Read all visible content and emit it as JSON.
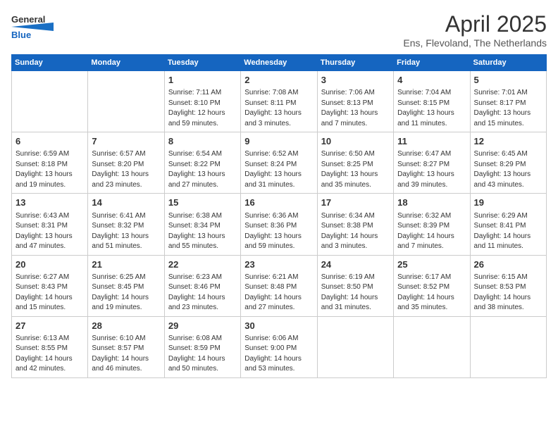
{
  "header": {
    "logo_general": "General",
    "logo_blue": "Blue",
    "month": "April 2025",
    "location": "Ens, Flevoland, The Netherlands"
  },
  "weekdays": [
    "Sunday",
    "Monday",
    "Tuesday",
    "Wednesday",
    "Thursday",
    "Friday",
    "Saturday"
  ],
  "weeks": [
    [
      {
        "day": "",
        "info": ""
      },
      {
        "day": "",
        "info": ""
      },
      {
        "day": "1",
        "info": "Sunrise: 7:11 AM\nSunset: 8:10 PM\nDaylight: 12 hours and 59 minutes."
      },
      {
        "day": "2",
        "info": "Sunrise: 7:08 AM\nSunset: 8:11 PM\nDaylight: 13 hours and 3 minutes."
      },
      {
        "day": "3",
        "info": "Sunrise: 7:06 AM\nSunset: 8:13 PM\nDaylight: 13 hours and 7 minutes."
      },
      {
        "day": "4",
        "info": "Sunrise: 7:04 AM\nSunset: 8:15 PM\nDaylight: 13 hours and 11 minutes."
      },
      {
        "day": "5",
        "info": "Sunrise: 7:01 AM\nSunset: 8:17 PM\nDaylight: 13 hours and 15 minutes."
      }
    ],
    [
      {
        "day": "6",
        "info": "Sunrise: 6:59 AM\nSunset: 8:18 PM\nDaylight: 13 hours and 19 minutes."
      },
      {
        "day": "7",
        "info": "Sunrise: 6:57 AM\nSunset: 8:20 PM\nDaylight: 13 hours and 23 minutes."
      },
      {
        "day": "8",
        "info": "Sunrise: 6:54 AM\nSunset: 8:22 PM\nDaylight: 13 hours and 27 minutes."
      },
      {
        "day": "9",
        "info": "Sunrise: 6:52 AM\nSunset: 8:24 PM\nDaylight: 13 hours and 31 minutes."
      },
      {
        "day": "10",
        "info": "Sunrise: 6:50 AM\nSunset: 8:25 PM\nDaylight: 13 hours and 35 minutes."
      },
      {
        "day": "11",
        "info": "Sunrise: 6:47 AM\nSunset: 8:27 PM\nDaylight: 13 hours and 39 minutes."
      },
      {
        "day": "12",
        "info": "Sunrise: 6:45 AM\nSunset: 8:29 PM\nDaylight: 13 hours and 43 minutes."
      }
    ],
    [
      {
        "day": "13",
        "info": "Sunrise: 6:43 AM\nSunset: 8:31 PM\nDaylight: 13 hours and 47 minutes."
      },
      {
        "day": "14",
        "info": "Sunrise: 6:41 AM\nSunset: 8:32 PM\nDaylight: 13 hours and 51 minutes."
      },
      {
        "day": "15",
        "info": "Sunrise: 6:38 AM\nSunset: 8:34 PM\nDaylight: 13 hours and 55 minutes."
      },
      {
        "day": "16",
        "info": "Sunrise: 6:36 AM\nSunset: 8:36 PM\nDaylight: 13 hours and 59 minutes."
      },
      {
        "day": "17",
        "info": "Sunrise: 6:34 AM\nSunset: 8:38 PM\nDaylight: 14 hours and 3 minutes."
      },
      {
        "day": "18",
        "info": "Sunrise: 6:32 AM\nSunset: 8:39 PM\nDaylight: 14 hours and 7 minutes."
      },
      {
        "day": "19",
        "info": "Sunrise: 6:29 AM\nSunset: 8:41 PM\nDaylight: 14 hours and 11 minutes."
      }
    ],
    [
      {
        "day": "20",
        "info": "Sunrise: 6:27 AM\nSunset: 8:43 PM\nDaylight: 14 hours and 15 minutes."
      },
      {
        "day": "21",
        "info": "Sunrise: 6:25 AM\nSunset: 8:45 PM\nDaylight: 14 hours and 19 minutes."
      },
      {
        "day": "22",
        "info": "Sunrise: 6:23 AM\nSunset: 8:46 PM\nDaylight: 14 hours and 23 minutes."
      },
      {
        "day": "23",
        "info": "Sunrise: 6:21 AM\nSunset: 8:48 PM\nDaylight: 14 hours and 27 minutes."
      },
      {
        "day": "24",
        "info": "Sunrise: 6:19 AM\nSunset: 8:50 PM\nDaylight: 14 hours and 31 minutes."
      },
      {
        "day": "25",
        "info": "Sunrise: 6:17 AM\nSunset: 8:52 PM\nDaylight: 14 hours and 35 minutes."
      },
      {
        "day": "26",
        "info": "Sunrise: 6:15 AM\nSunset: 8:53 PM\nDaylight: 14 hours and 38 minutes."
      }
    ],
    [
      {
        "day": "27",
        "info": "Sunrise: 6:13 AM\nSunset: 8:55 PM\nDaylight: 14 hours and 42 minutes."
      },
      {
        "day": "28",
        "info": "Sunrise: 6:10 AM\nSunset: 8:57 PM\nDaylight: 14 hours and 46 minutes."
      },
      {
        "day": "29",
        "info": "Sunrise: 6:08 AM\nSunset: 8:59 PM\nDaylight: 14 hours and 50 minutes."
      },
      {
        "day": "30",
        "info": "Sunrise: 6:06 AM\nSunset: 9:00 PM\nDaylight: 14 hours and 53 minutes."
      },
      {
        "day": "",
        "info": ""
      },
      {
        "day": "",
        "info": ""
      },
      {
        "day": "",
        "info": ""
      }
    ]
  ]
}
